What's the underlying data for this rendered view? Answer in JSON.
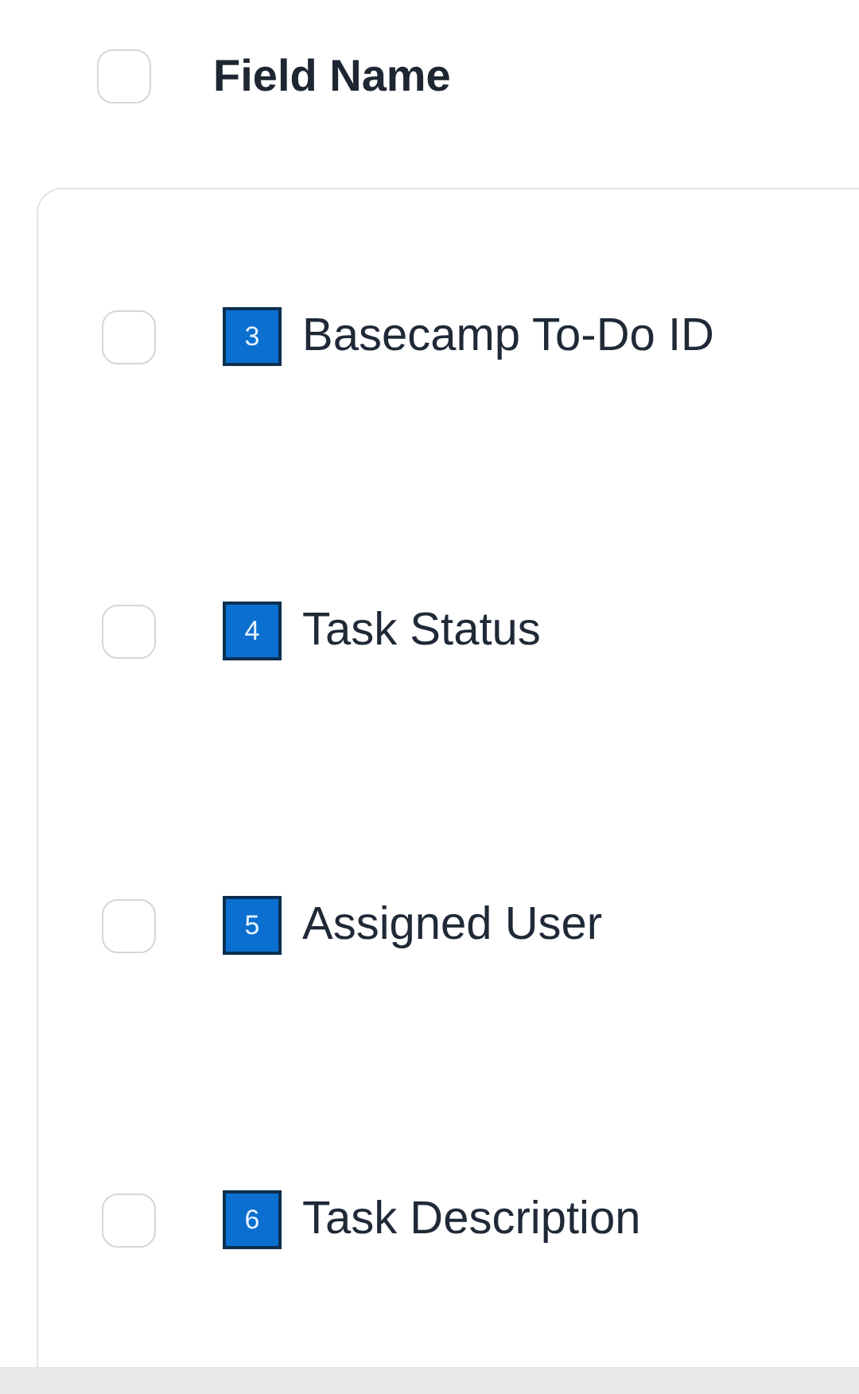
{
  "header": {
    "checked": false,
    "label": "Field Name"
  },
  "fields": [
    {
      "number": "3",
      "name": "Basecamp To-Do ID",
      "checked": false
    },
    {
      "number": "4",
      "name": "Task Status",
      "checked": false
    },
    {
      "number": "5",
      "name": "Assigned User",
      "checked": false
    },
    {
      "number": "6",
      "name": "Task Description",
      "checked": false
    }
  ]
}
